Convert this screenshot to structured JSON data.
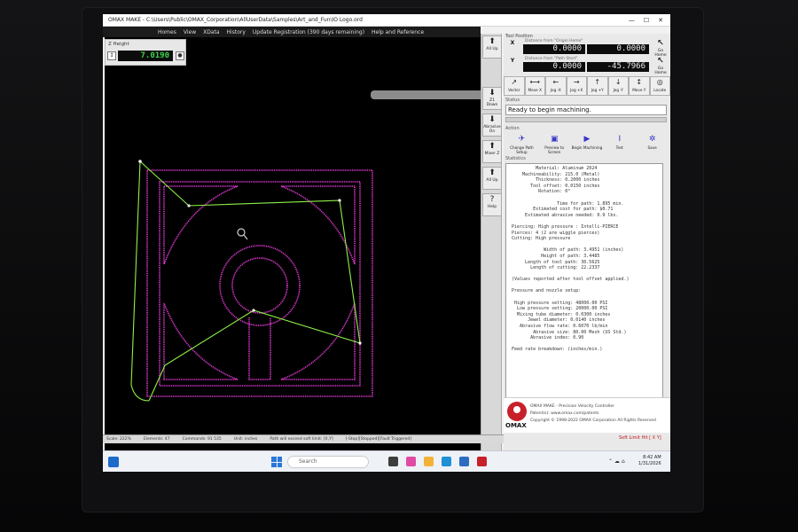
{
  "window": {
    "title": "OMAX MAKE - C:\\Users\\Public\\OMAX_Corporation\\AllUserData\\Samples\\Art_and_Fun\\IO Logo.ord",
    "min": "—",
    "max": "☐",
    "close": "✕"
  },
  "menu": [
    "Homes",
    "View",
    "XData",
    "History",
    "Update Registration (390 days remaining)",
    "Help and Reference"
  ],
  "zheight": {
    "label": "Z Height",
    "value": "7.0190"
  },
  "vtools": [
    {
      "label": "All Up",
      "glyph": "⬆"
    },
    {
      "label": "Z1 Down",
      "glyph": "⬇"
    },
    {
      "label": "Abrasive On",
      "glyph": "⬇"
    },
    {
      "label": "Mixer Z",
      "glyph": "⬆"
    },
    {
      "label": "All Up",
      "glyph": "⬆"
    },
    {
      "label": "Help",
      "glyph": "?"
    }
  ],
  "tool_position": {
    "label": "Tool Position",
    "x": {
      "axis": "X",
      "sub": "Distance from \"Origin Home\"",
      "abs": "0.0000",
      "rel": "0.0000",
      "side": "Go Home"
    },
    "y": {
      "axis": "Y",
      "sub": "Distance from \"Path Start\"",
      "abs": "0.0000",
      "rel": "-45.7966",
      "side": "Go Home"
    }
  },
  "jog": [
    {
      "label": "Vector",
      "glyph": "↗"
    },
    {
      "label": "Move X",
      "glyph": "⟷"
    },
    {
      "label": "Jog -X",
      "glyph": "←"
    },
    {
      "label": "Jog +X",
      "glyph": "→"
    },
    {
      "label": "Jog +Y",
      "glyph": "↑"
    },
    {
      "label": "Jog -Y",
      "glyph": "↓"
    },
    {
      "label": "Move Y",
      "glyph": "↕"
    },
    {
      "label": "Locate",
      "glyph": "◎"
    }
  ],
  "status": {
    "label": "Status",
    "text": "Ready to begin machining.",
    "progress": 0
  },
  "actions": {
    "label": "Action",
    "items": [
      {
        "label": "Change Path Setup",
        "glyph": "✈"
      },
      {
        "label": "Preview to Screen",
        "glyph": "▣"
      },
      {
        "label": "Begin Machining",
        "glyph": "▶"
      },
      {
        "label": "Test",
        "glyph": "Ι"
      },
      {
        "label": "Save",
        "glyph": "✲"
      }
    ]
  },
  "statistics": {
    "label": "Statistics",
    "lines": [
      "          Material: Aluminum 2024",
      "     Machineability: 215.0 (Metal)",
      "          Thickness: 0.2000 inches",
      "        Tool offset: 0.0150 inches",
      "           Rotation: 0°",
      "",
      "                  Time for path: 1.895 min.",
      "         Estimated cost for path: $0.71",
      "      Estimated abrasive needed: 0.9 lbs.",
      "",
      " Piercing: High pressure : Intelli-PIERCE",
      " Pierces: 4 (2 are wiggle pierces)",
      " Cutting: High pressure",
      "",
      "             Width of path: 3.4951 (inches)",
      "            Height of path: 3.4485",
      "      Length of tool path: 30.5625",
      "        Length of cutting: 22.2337",
      "",
      " (Values reported after tool offset applied.)",
      "",
      " Pressure and nozzle setup:",
      "",
      "  High pressure setting: 48000.00 PSI",
      "   Low pressure setting: 20000.00 PSI",
      "   Mixing tube diameter: 0.0300 inches",
      "       Jewel diameter: 0.0140 inches",
      "    Abrasive flow rate: 0.6070 lb/min",
      "         Abrasive size: 80.00 Mesh (US Std.)",
      "        Abrasive index: 0.90",
      "",
      " Feed rate breakdown: (inches/min.)"
    ]
  },
  "logo": {
    "brand": "OMAX",
    "line1": "OMAX MAKE - Precision Velocity Controller",
    "line2": "Patent(s): www.omax.com/patents",
    "line3": "Copyright © 1998-2022 OMAX Corporation All Rights Reserved"
  },
  "soft_limit": "Soft Limit Hit [ X  Y]",
  "statusbar": [
    "Scale: 222%",
    "Elements: 47",
    "Commands: 91 535",
    "Unit: inches",
    "Path will exceed soft limit: [X,Y]",
    "[-Stop][Stopped][Fault Triggered]"
  ],
  "taskbar": {
    "search": "Search",
    "time": "8:42 AM",
    "date": "1/31/2026"
  },
  "colors": {
    "path": "#e53ad8",
    "traverse": "#8ef046",
    "canvas": "#000000",
    "accent": "#3a36c9"
  }
}
